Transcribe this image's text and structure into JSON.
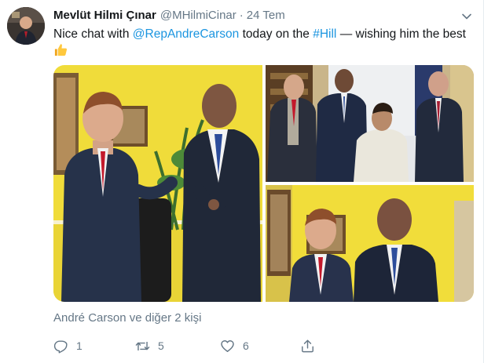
{
  "tweet": {
    "author_name": "Mevlüt Hilmi Çınar",
    "author_handle": "@MHilmiCinar",
    "separator": "·",
    "timestamp": "24 Tem",
    "text_before": "Nice chat with ",
    "mention": "@RepAndreCarson",
    "text_middle": " today on the ",
    "hashtag": "#Hill",
    "text_after": " — wishing him the best",
    "emoji": "👍",
    "likes_line": "André Carson ve diğer 2 kişi"
  },
  "actions": {
    "reply_icon": "reply-icon",
    "reply_count": "1",
    "retweet_icon": "retweet-icon",
    "retweet_count": "5",
    "like_icon": "heart-icon",
    "like_count": "6",
    "share_icon": "share-icon"
  },
  "colors": {
    "link": "#1b95e0",
    "secondary_text": "#657786",
    "primary_text": "#14171a",
    "wall_yellow": "#f3e03a"
  }
}
